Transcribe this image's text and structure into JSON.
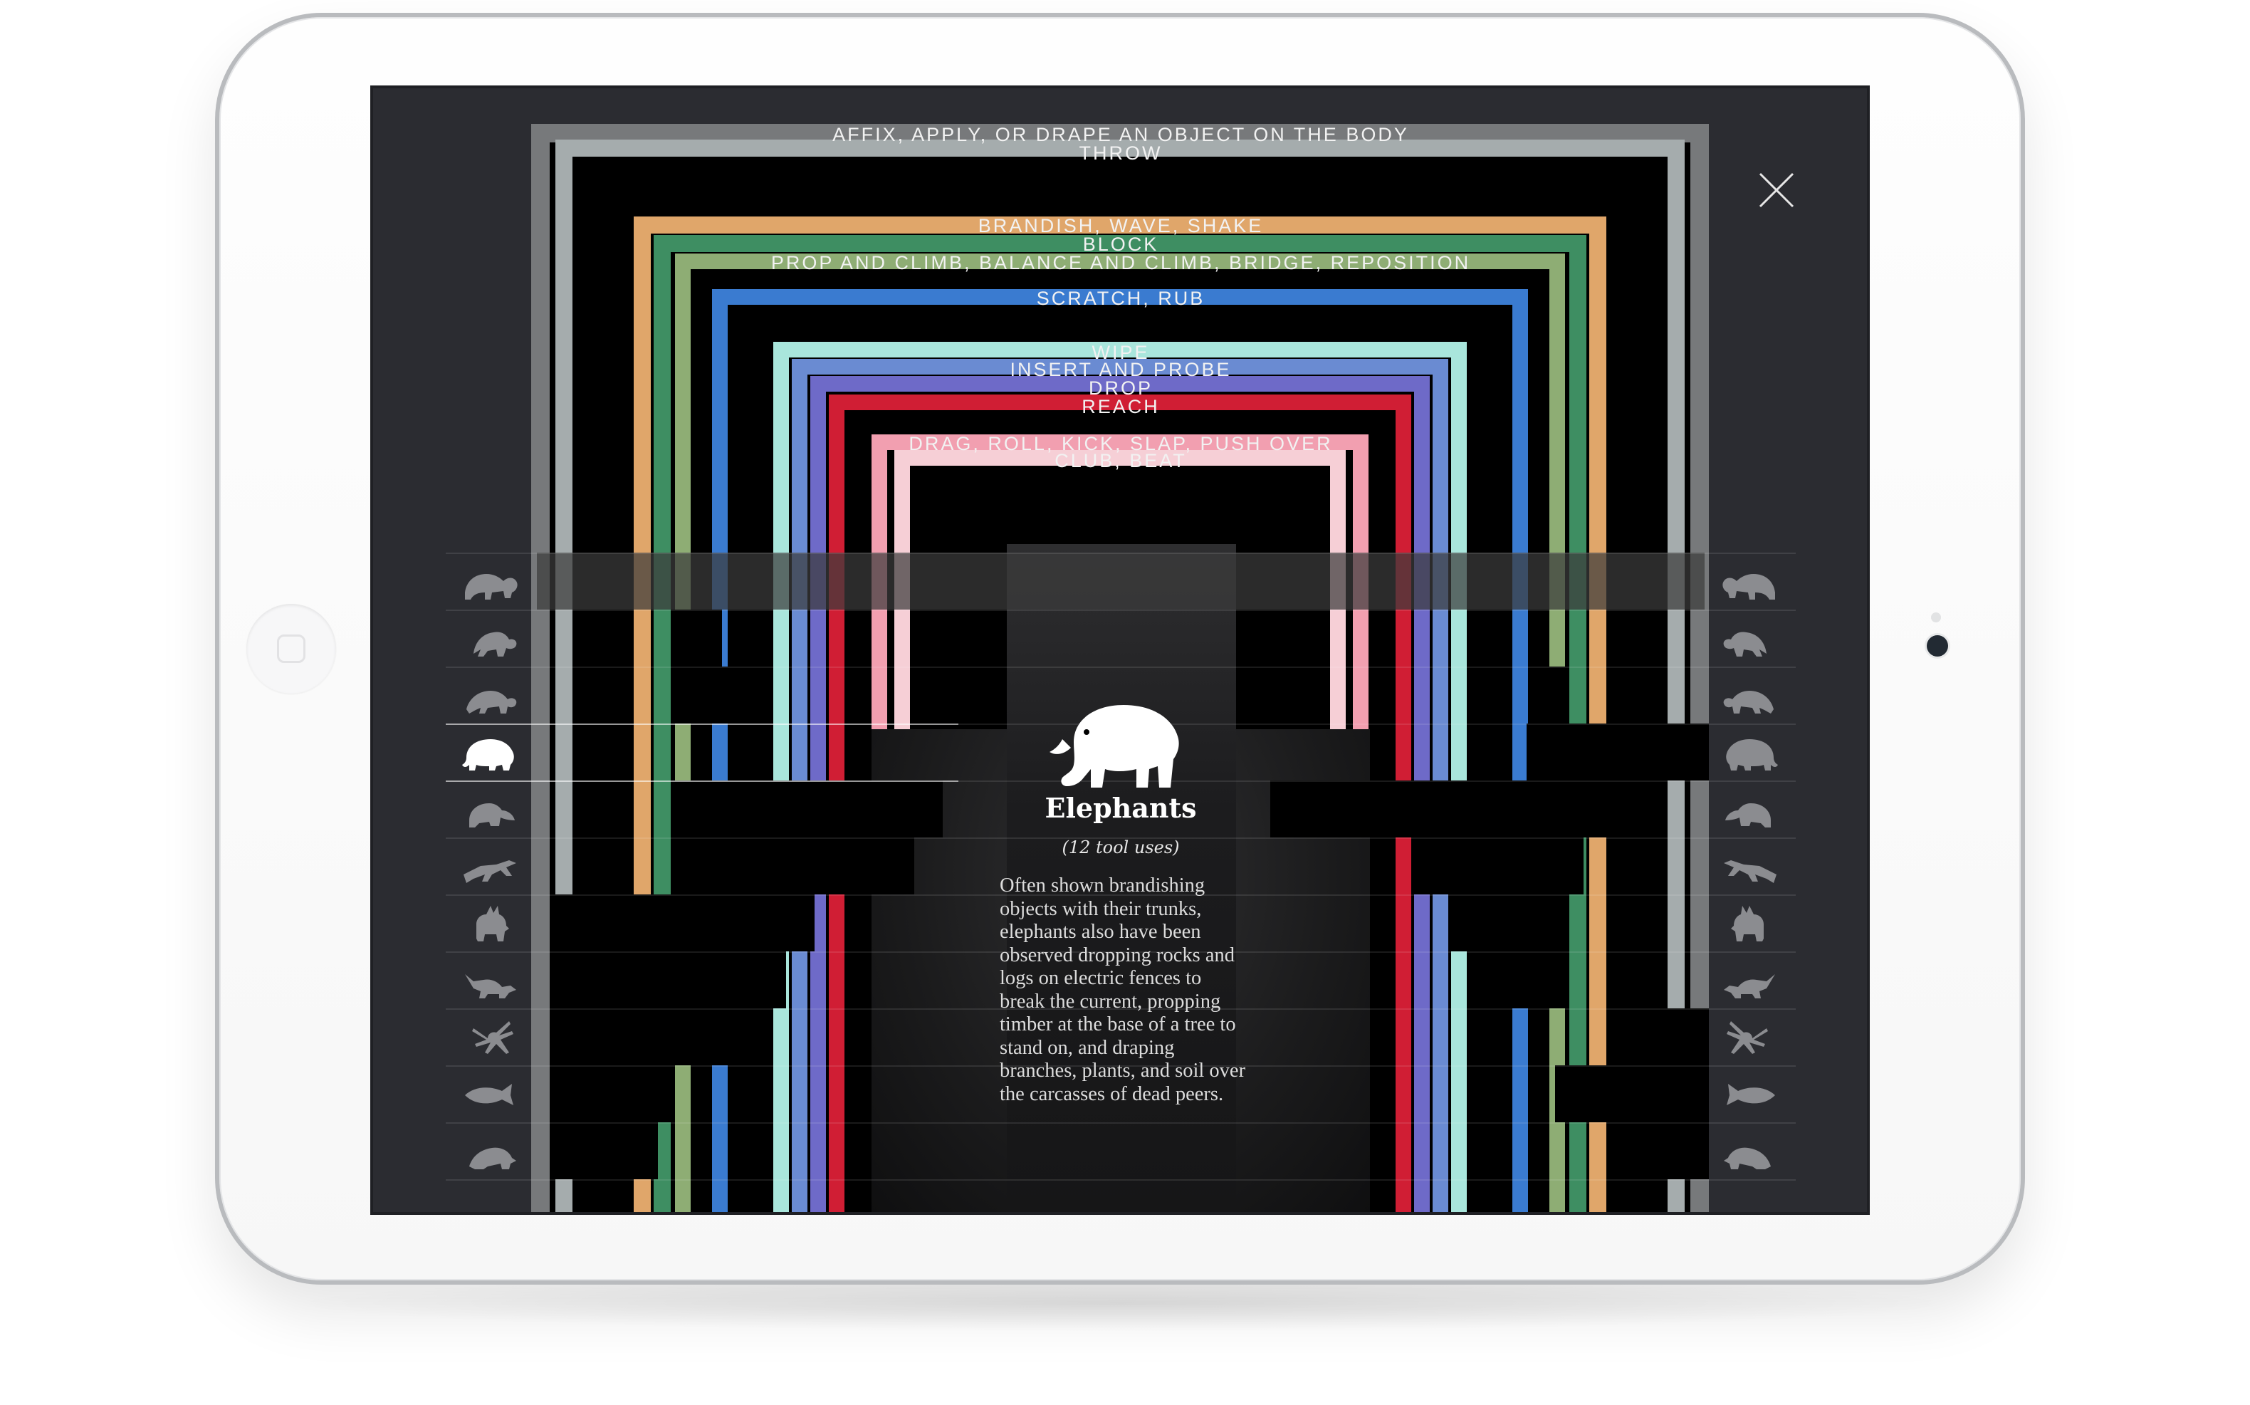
{
  "frames": [
    {
      "label": "AFFIX, APPLY, OR DRAPE AN OBJECT ON THE BODY",
      "color": "#77797b"
    },
    {
      "label": "THROW",
      "color": "#a5acad"
    },
    {
      "label": "BRANDISH, WAVE, SHAKE",
      "color": "#e0a66a"
    },
    {
      "label": "BLOCK",
      "color": "#3e8e62"
    },
    {
      "label": "PROP AND CLIMB, BALANCE AND CLIMB, BRIDGE, REPOSITION",
      "color": "#8ead74"
    },
    {
      "label": "SCRATCH, RUB",
      "color": "#3a7bd0"
    },
    {
      "label": "WIPE",
      "color": "#a9e6dc"
    },
    {
      "label": "INSERT AND PROBE",
      "color": "#6a8bd2"
    },
    {
      "label": "DROP",
      "color": "#6e6ac8"
    },
    {
      "label": "REACH",
      "color": "#d01e34"
    },
    {
      "label": "DRAG, ROLL, KICK, SLAP, PUSH OVER",
      "color": "#f29fb0"
    },
    {
      "label": "CLUB, BEAT",
      "color": "#f6cfd6"
    }
  ],
  "close_icon": "close-icon",
  "left_animals": [
    {
      "name": "orangutans-icon"
    },
    {
      "name": "chimpanzees-icon"
    },
    {
      "name": "monkeys-icon"
    },
    {
      "name": "elephants-icon",
      "active": true
    },
    {
      "name": "beavers-icon"
    },
    {
      "name": "insects-icon"
    },
    {
      "name": "deer-icon"
    },
    {
      "name": "lemurs-icon"
    },
    {
      "name": "spiders-icon"
    },
    {
      "name": "fish-icon"
    },
    {
      "name": "frogs-icon"
    }
  ],
  "right_animals": [
    {
      "name": "gorillas-icon"
    },
    {
      "name": "baboons-icon"
    },
    {
      "name": "birds-icon"
    },
    {
      "name": "otters-icon"
    },
    {
      "name": "bears-icon"
    },
    {
      "name": "dolphins-icon"
    },
    {
      "name": "octopus-icon"
    },
    {
      "name": "crabs-icon"
    },
    {
      "name": "rodents-icon"
    },
    {
      "name": "crocodiles-icon"
    },
    {
      "name": "urchins-icon"
    }
  ],
  "selected": {
    "icon": "elephant-icon",
    "title": "Elephants",
    "subtitle": "(12 tool uses)",
    "body": "Often shown brandishing objects with their trunks, elephants also have been observed dropping rocks and logs on electric fences to break the current, propping timber at the base of a tree to stand on, and draping branches, plants, and soil over the carcasses of dead peers."
  },
  "colors": {
    "screen_bg": "#2b2c31",
    "stage_bg": "#000000",
    "text": "#f2f2f2"
  }
}
